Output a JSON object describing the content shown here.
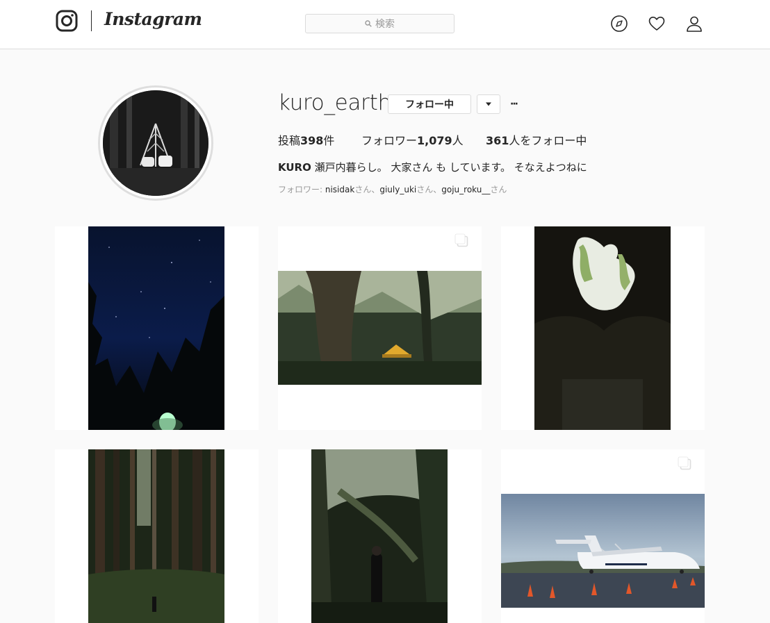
{
  "header": {
    "logo_text": "Instagram",
    "search_placeholder": "検索",
    "icons": [
      "instagram-glyph-icon",
      "search-icon",
      "explore-compass-icon",
      "heart-icon",
      "person-icon"
    ]
  },
  "profile": {
    "username": "kuro_earth",
    "follow_button": "フォロー中",
    "more_button": "···",
    "stats": {
      "posts_prefix": "投稿",
      "posts": "398",
      "posts_suffix": "件",
      "followers_prefix": "フォロワー",
      "followers": "1,079",
      "followers_suffix": "人",
      "following": "361",
      "following_suffix": "人をフォロー中"
    },
    "bio_name": "KURO",
    "bio_text": "瀬戸内暮らし。 大家さん も しています。 そなえよつねに",
    "followed_by": {
      "label": "フォロワー: ",
      "names": [
        "nisidak",
        "giuly_uki",
        "goju_roku__"
      ],
      "honorific": "さん",
      "separator": "、"
    }
  },
  "posts": [
    {
      "subject": "starry night sky over forest with lit tent",
      "multi": true
    },
    {
      "subject": "yellow tent in mossy forest",
      "multi": true
    },
    {
      "subject": "looking up from dark cave opening",
      "multi": true
    },
    {
      "subject": "person walking on forest trail among tall cedars",
      "multi": true
    },
    {
      "subject": "person standing in dark forest",
      "multi": false
    },
    {
      "subject": "propeller airplane on tarmac with traffic cones",
      "multi": true
    }
  ],
  "colors": {
    "background": "#fafafa",
    "border": "#dbdbdb",
    "text": "#262626",
    "muted": "#999999"
  }
}
